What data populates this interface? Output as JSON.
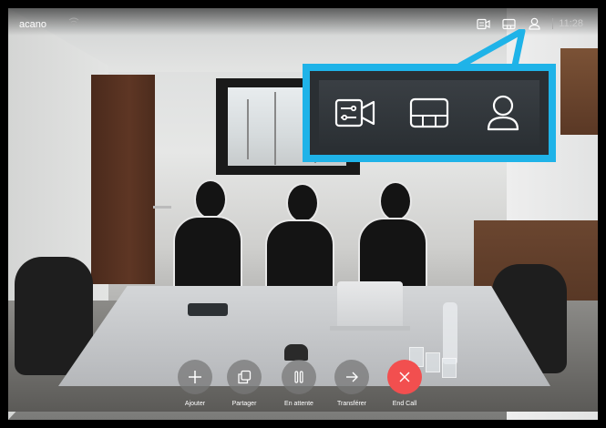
{
  "status_bar": {
    "brand": "acano",
    "time": "11:28",
    "icons": [
      "camera-control-icon",
      "layout-icon",
      "self-view-icon"
    ]
  },
  "callout": {
    "icons": [
      "camera-control-icon",
      "layout-icon",
      "self-view-icon"
    ]
  },
  "controls": [
    {
      "label": "Ajouter",
      "icon": "plus-icon"
    },
    {
      "label": "Partager",
      "icon": "share-icon"
    },
    {
      "label": "En attente",
      "icon": "pause-icon"
    },
    {
      "label": "Transférer",
      "icon": "arrow-right-icon"
    },
    {
      "label": "End Call",
      "icon": "close-icon"
    }
  ],
  "colors": {
    "callout_border": "#1fb3e8",
    "end_call": "#f24f4f",
    "control_button": "#787878"
  }
}
